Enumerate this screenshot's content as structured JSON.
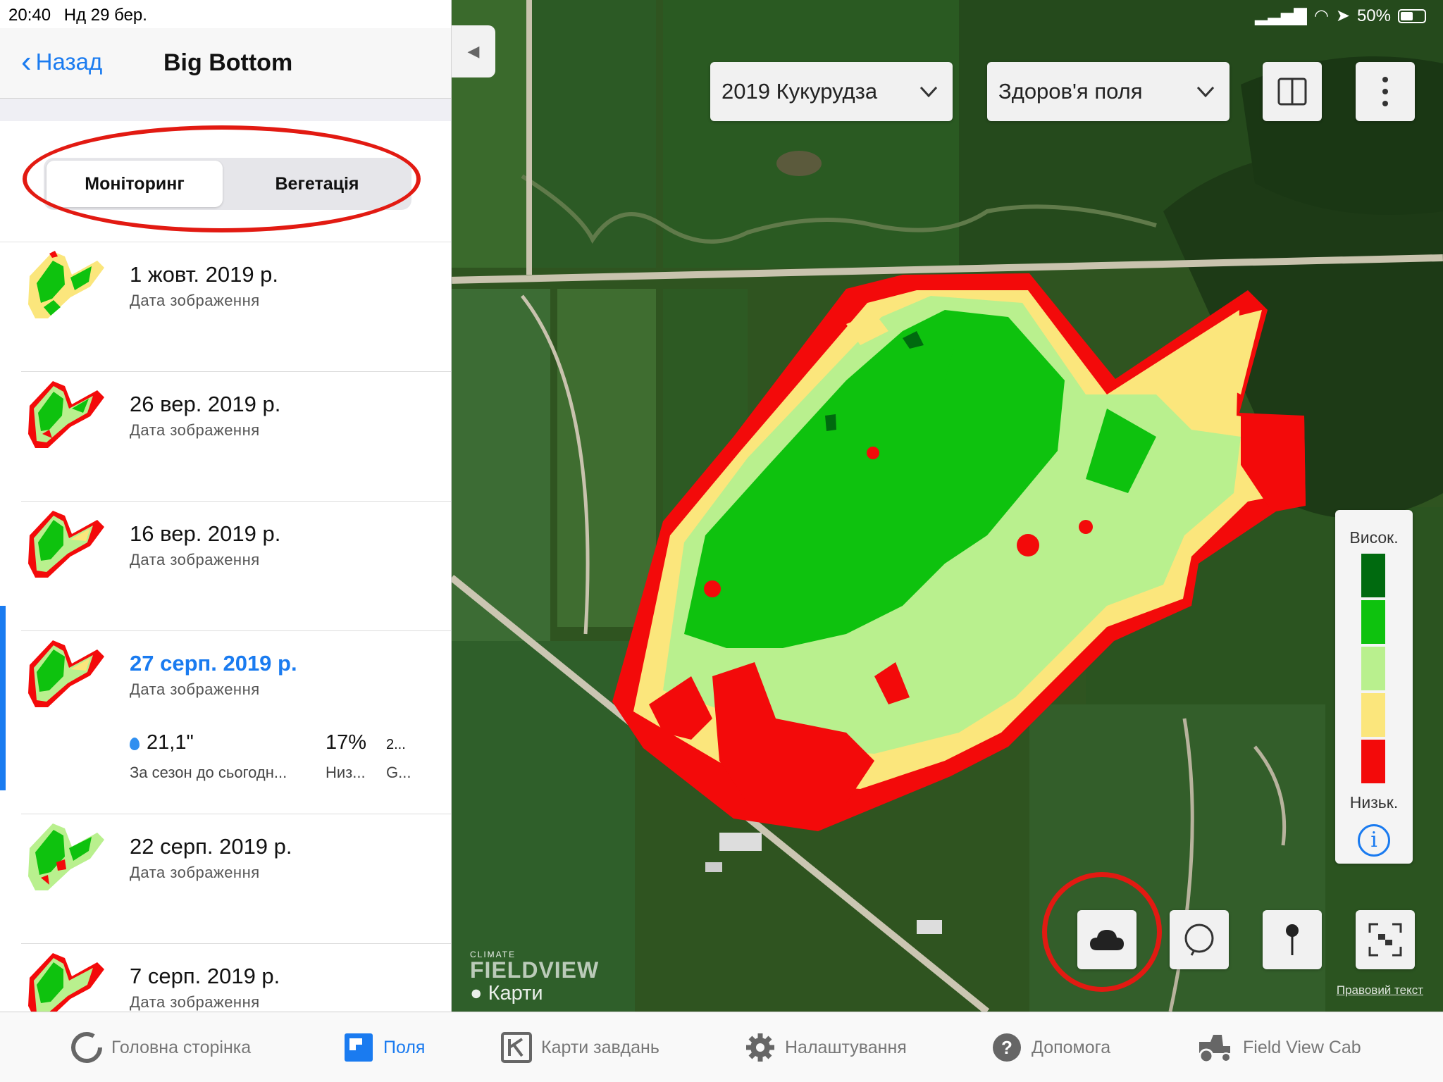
{
  "status_bar": {
    "time": "20:40",
    "date": "Нд 29 бер.",
    "battery": "50%"
  },
  "nav": {
    "back_label": "Назад",
    "title": "Big Bottom"
  },
  "segmented": {
    "options": [
      "Моніторинг",
      "Вегетація"
    ],
    "selected": "Моніторинг"
  },
  "imagery_list": [
    {
      "date": "1 жовт. 2019 р.",
      "sub": "Дата зображення"
    },
    {
      "date": "26 вер. 2019 р.",
      "sub": "Дата зображення"
    },
    {
      "date": "16 вер. 2019 р.",
      "sub": "Дата зображення"
    },
    {
      "date": "27 серп. 2019 р.",
      "sub": "Дата зображення",
      "selected": true,
      "stats": [
        {
          "value": "21,1\"",
          "label": "За сезон до сьогодн..."
        },
        {
          "value": "17%",
          "label": "Низ..."
        },
        {
          "value": "2...",
          "label": "G..."
        }
      ]
    },
    {
      "date": "22 серп. 2019 р.",
      "sub": "Дата зображення"
    },
    {
      "date": "7 серп. 2019 р.",
      "sub": "Дата зображення"
    }
  ],
  "map": {
    "season_select": "2019 Кукурудза",
    "layer_select": "Здоров'я поля",
    "legend": {
      "high_label": "Висок.",
      "low_label": "Низьк.",
      "colors": [
        "#006a0f",
        "#0ec20e",
        "#b9f08e",
        "#fbe67c",
        "#f30a0a"
      ]
    },
    "brand_small": "CLIMATE",
    "brand_big": "FIELDVIEW",
    "maps_label": "Карти",
    "legal_label": "Правовий текст",
    "tools": [
      "cloud-icon",
      "lasso-icon",
      "pin-icon",
      "scan-icon"
    ]
  },
  "tabbar": [
    {
      "label": "Головна сторінка",
      "icon": "home-ring-icon"
    },
    {
      "label": "Поля",
      "icon": "fields-icon",
      "active": true
    },
    {
      "label": "Карти завдань",
      "icon": "prescription-maps-icon"
    },
    {
      "label": "Налаштування",
      "icon": "gear-icon"
    },
    {
      "label": "Допомога",
      "icon": "help-icon"
    },
    {
      "label": "Field View Cab",
      "icon": "tractor-icon"
    }
  ]
}
